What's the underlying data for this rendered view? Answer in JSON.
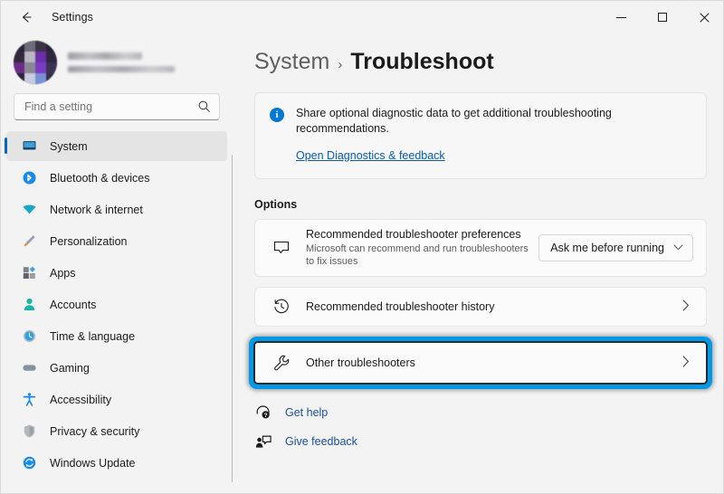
{
  "window": {
    "titlebar": {
      "back_label": "back-arrow",
      "title": "Settings",
      "minimize": "minimize",
      "maximize": "maximize",
      "close": "close"
    }
  },
  "sidebar": {
    "account": {
      "name_redacted": "",
      "email_redacted": ""
    },
    "search": {
      "placeholder": "Find a setting",
      "value": "",
      "icon": "search-icon"
    },
    "items": [
      {
        "label": "System",
        "icon": "monitor-icon",
        "selected": true
      },
      {
        "label": "Bluetooth & devices",
        "icon": "bluetooth-icon",
        "selected": false
      },
      {
        "label": "Network & internet",
        "icon": "wifi-icon",
        "selected": false
      },
      {
        "label": "Personalization",
        "icon": "paintbrush-icon",
        "selected": false
      },
      {
        "label": "Apps",
        "icon": "apps-grid-icon",
        "selected": false
      },
      {
        "label": "Accounts",
        "icon": "person-icon",
        "selected": false
      },
      {
        "label": "Time & language",
        "icon": "clock-globe-icon",
        "selected": false
      },
      {
        "label": "Gaming",
        "icon": "gamepad-icon",
        "selected": false
      },
      {
        "label": "Accessibility",
        "icon": "accessibility-icon",
        "selected": false
      },
      {
        "label": "Privacy & security",
        "icon": "shield-icon",
        "selected": false
      },
      {
        "label": "Windows Update",
        "icon": "update-icon",
        "selected": false
      }
    ]
  },
  "main": {
    "breadcrumb": {
      "parent": "System",
      "separator": "›",
      "current": "Troubleshoot"
    },
    "info_banner": {
      "icon": "info-icon",
      "text": "Share optional diagnostic data to get additional troubleshooting recommendations.",
      "link": "Open Diagnostics & feedback"
    },
    "section_title": "Options",
    "cards": [
      {
        "icon": "speech-bubble-icon",
        "title": "Recommended troubleshooter preferences",
        "subtitle": "Microsoft can recommend and run troubleshooters to fix issues",
        "control": "dropdown",
        "dropdown_value": "Ask me before running",
        "dropdown_chevron": "⌄"
      },
      {
        "icon": "history-clock-icon",
        "title": "Recommended troubleshooter history",
        "subtitle": "",
        "control": "chevron",
        "chevron": "›"
      },
      {
        "icon": "wrench-icon",
        "title": "Other troubleshooters",
        "subtitle": "",
        "control": "chevron",
        "chevron": "›",
        "highlighted": true
      }
    ],
    "footer_links": [
      {
        "icon": "get-help-icon",
        "label": "Get help"
      },
      {
        "icon": "give-feedback-icon",
        "label": "Give feedback"
      }
    ]
  },
  "colors": {
    "accent_blue": "#0067c0",
    "link_blue": "#0a5ba8",
    "highlight_box": "#0099e8",
    "info_blue": "#0078d4",
    "window_bg": "#f3f3f3",
    "card_bg": "#fbfbfb"
  }
}
